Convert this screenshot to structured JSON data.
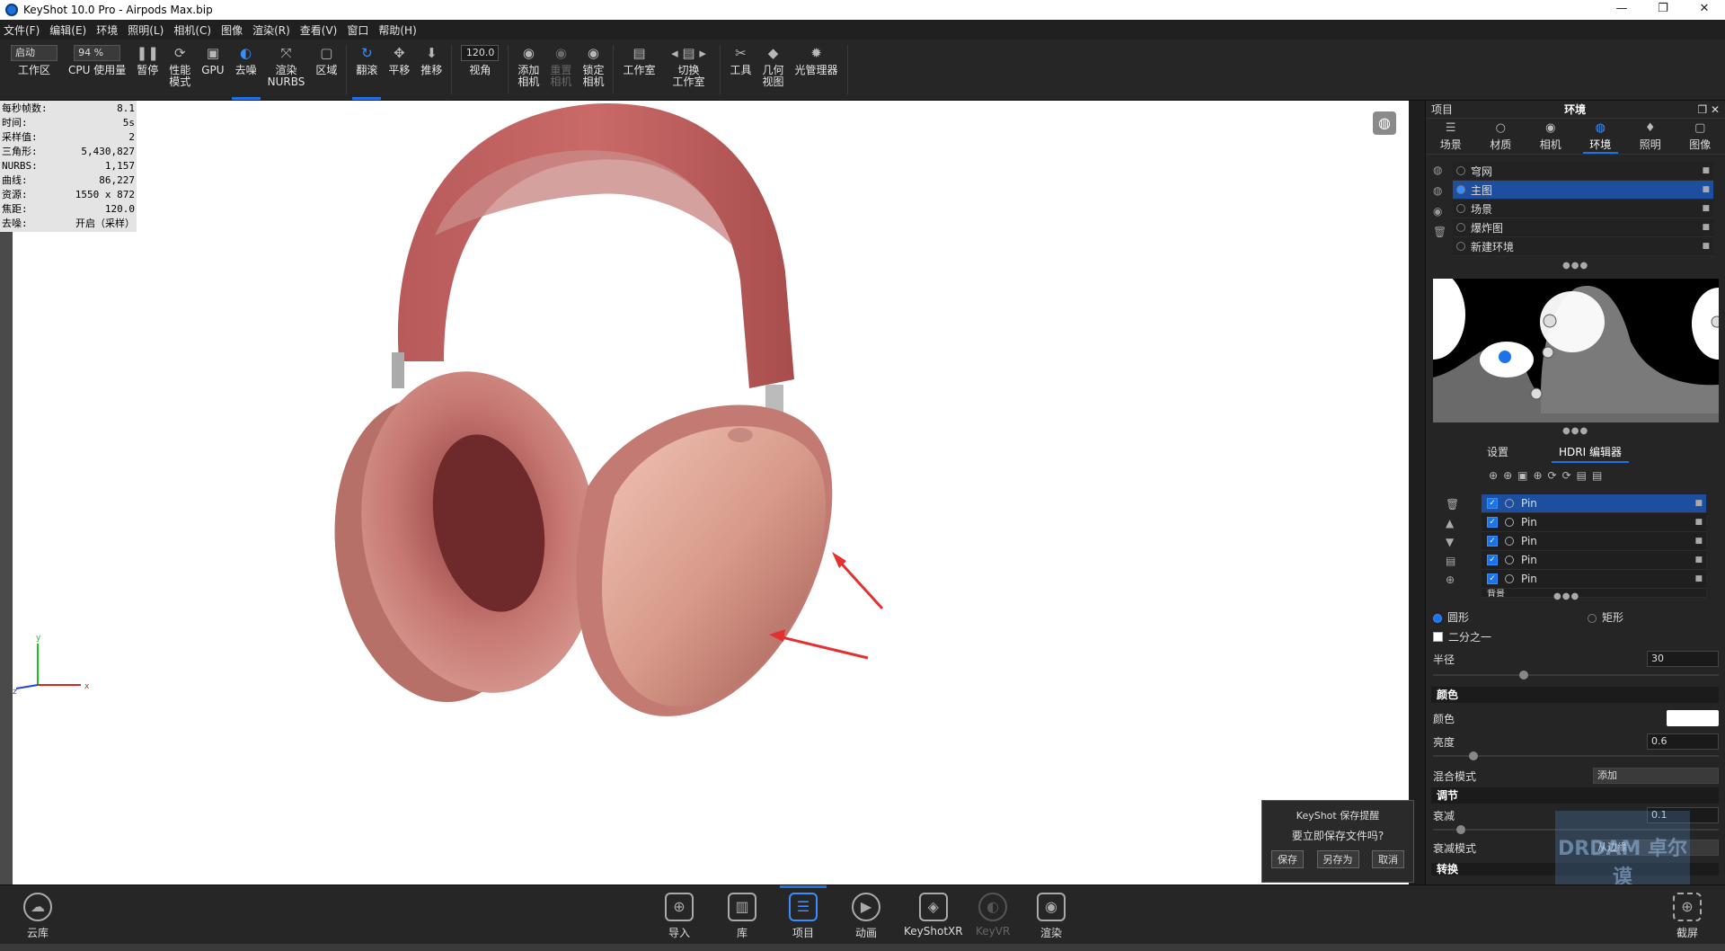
{
  "window": {
    "title": "KeyShot 10.0 Pro  -  Airpods Max.bip"
  },
  "menu": [
    "文件(F)",
    "编辑(E)",
    "环境",
    "照明(L)",
    "相机(C)",
    "图像",
    "渲染(R)",
    "查看(V)",
    "窗口",
    "帮助(H)"
  ],
  "toolbar": {
    "mode_select": "启动",
    "zoom_select": "94 %",
    "fov_value": "120.0",
    "items": [
      {
        "label": "工作区"
      },
      {
        "label": "CPU 使用量"
      },
      {
        "label": "暂停",
        "icon": "❚❚"
      },
      {
        "label": "性能\n模式",
        "icon": "⟳"
      },
      {
        "label": "GPU",
        "icon": "▣"
      },
      {
        "label": "去噪",
        "icon": "◐"
      },
      {
        "label": "渲染\nNURBS",
        "icon": "⤧"
      },
      {
        "label": "区域",
        "icon": "▢"
      },
      {
        "label": "翻滚",
        "icon": "↻"
      },
      {
        "label": "平移",
        "icon": "✥"
      },
      {
        "label": "推移",
        "icon": "⬇"
      },
      {
        "label": "视角"
      },
      {
        "label": "添加\n相机",
        "icon": "◉"
      },
      {
        "label": "重置\n相机",
        "icon": "◉"
      },
      {
        "label": "锁定\n相机",
        "icon": "◉"
      },
      {
        "label": "工作室",
        "icon": "▤"
      },
      {
        "label": "切换\n工作室",
        "icon": "◂ ▤ ▸"
      },
      {
        "label": "工具",
        "icon": "✂"
      },
      {
        "label": "几何\n视图",
        "icon": "◆"
      },
      {
        "label": "光管理器",
        "icon": "✹"
      }
    ]
  },
  "stats": [
    {
      "k": "每秒帧数:",
      "v": "8.1"
    },
    {
      "k": "时间:",
      "v": "5s"
    },
    {
      "k": "采样值:",
      "v": "2"
    },
    {
      "k": "三角形:",
      "v": "5,430,827"
    },
    {
      "k": "NURBS:",
      "v": "1,157"
    },
    {
      "k": "曲线:",
      "v": "86,227"
    },
    {
      "k": "资源:",
      "v": "1550 x 872"
    },
    {
      "k": "焦距:",
      "v": "120.0"
    },
    {
      "k": "去噪:",
      "v": "开启（采样）"
    }
  ],
  "save_dialog": {
    "title": "KeyShot 保存提醒",
    "message": "要立即保存文件吗?",
    "save": "保存",
    "save_as": "另存为",
    "cancel": "取消"
  },
  "panel": {
    "header_left": "项目",
    "header_center": "环境",
    "tabs": [
      {
        "label": "场景",
        "icon": "☰"
      },
      {
        "label": "材质",
        "icon": "○"
      },
      {
        "label": "相机",
        "icon": "◉"
      },
      {
        "label": "环境",
        "icon": "◍"
      },
      {
        "label": "照明",
        "icon": "♦"
      },
      {
        "label": "图像",
        "icon": "▢"
      }
    ],
    "environments": [
      "穹网",
      "主图",
      "场景",
      "爆炸图",
      "新建环境"
    ],
    "subtabs": [
      "设置",
      "HDRI 编辑器"
    ],
    "pins": [
      "Pin",
      "Pin",
      "Pin",
      "Pin",
      "Pin"
    ],
    "pin_last": "背景",
    "shape_circle": "圆形",
    "shape_rect": "矩形",
    "half_label": "二分之一",
    "radius_label": "半径",
    "radius_value": "30",
    "section_color": "颜色",
    "color_label": "颜色",
    "color_value": "#ffffff",
    "brightness_label": "亮度",
    "brightness_value": "0.6",
    "blend_label": "混合模式",
    "blend_value": "添加",
    "section_adjust": "调节",
    "falloff_label": "衰减",
    "falloff_value": "0.1",
    "falloff_mode_label": "衰减模式",
    "falloff_mode_value": "从边缘",
    "section_transform": "转换"
  },
  "bottom": {
    "cloud": "云库",
    "import": "导入",
    "library": "库",
    "project": "项目",
    "animation": "动画",
    "xr": "KeyShotXR",
    "vr": "KeyVR",
    "render": "渲染",
    "screenshot": "截屏"
  },
  "watermark": "DRDAM 卓尔谟"
}
